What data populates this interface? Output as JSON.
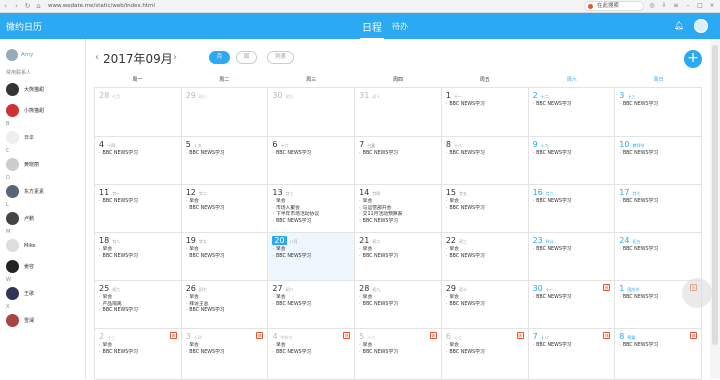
{
  "browser": {
    "url": "www.wedate.me/static/web/index.html",
    "search_text": "在此搜索"
  },
  "header": {
    "app_title": "微约日历",
    "tab_schedule": "日程",
    "tab_todo": "待办",
    "bell_icon": "bell-icon",
    "accent": "#2ba9f3"
  },
  "sidebar": {
    "me": "Amy",
    "frequent_label": "常用联系人",
    "contacts": [
      {
        "name": "大熊猫甜",
        "label": "",
        "top": 0
      },
      {
        "name": "小熊猫甜",
        "label": ""
      },
      {
        "name": "日伞",
        "label": "B"
      },
      {
        "name": "黄晓丽",
        "label": "C"
      },
      {
        "name": "东方素素",
        "label": "D"
      },
      {
        "name": "卢鹏",
        "label": "L"
      },
      {
        "name": "Mike",
        "label": "M"
      },
      {
        "name": "姜容",
        "label": ""
      },
      {
        "name": "王歌",
        "label": "W"
      },
      {
        "name": "雪澜",
        "label": "X"
      }
    ]
  },
  "toolbar": {
    "month": "2017年09月",
    "view_month": "月",
    "view_week": "周",
    "view_list": "列表",
    "add": "+"
  },
  "weekdays": [
    "周一",
    "周二",
    "周三",
    "周四",
    "周五",
    "周六",
    "周日"
  ],
  "weeks": [
    [
      {
        "day": "28",
        "lunar": "七月",
        "other": true,
        "events": []
      },
      {
        "day": "29",
        "lunar": "初八",
        "other": true,
        "events": []
      },
      {
        "day": "30",
        "lunar": "初九",
        "other": true,
        "events": []
      },
      {
        "day": "31",
        "lunar": "初十",
        "other": true,
        "events": []
      },
      {
        "day": "1",
        "lunar": "十一",
        "events": [
          "BBC NEWS学习"
        ]
      },
      {
        "day": "2",
        "lunar": "十二",
        "weekend": true,
        "events": [
          "BBC NEWS学习"
        ]
      },
      {
        "day": "3",
        "lunar": "十三",
        "weekend": true,
        "events": [
          "BBC NEWS学习"
        ]
      }
    ],
    [
      {
        "day": "4",
        "lunar": "十四",
        "events": [
          "BBC NEWS学习"
        ]
      },
      {
        "day": "5",
        "lunar": "十五",
        "events": [
          "BBC NEWS学习"
        ]
      },
      {
        "day": "6",
        "lunar": "十六",
        "events": [
          "BBC NEWS学习"
        ]
      },
      {
        "day": "7",
        "lunar": "白露",
        "events": [
          "BBC NEWS学习"
        ]
      },
      {
        "day": "8",
        "lunar": "十八",
        "events": [
          "BBC NEWS学习"
        ]
      },
      {
        "day": "9",
        "lunar": "十九",
        "weekend": true,
        "events": [
          "BBC NEWS学习"
        ]
      },
      {
        "day": "10",
        "lunar": "教师节",
        "weekend": true,
        "events": [
          "BBC NEWS学习"
        ]
      }
    ],
    [
      {
        "day": "11",
        "lunar": "廿一",
        "events": [
          "BBC NEWS学习"
        ]
      },
      {
        "day": "12",
        "lunar": "廿二",
        "events": [
          "早会",
          "BBC NEWS学习"
        ]
      },
      {
        "day": "13",
        "lunar": "廿三",
        "events": [
          "早会",
          "市场人聚会",
          "下半年市场活动协议",
          "BBC NEWS学习"
        ]
      },
      {
        "day": "14",
        "lunar": "廿四",
        "events": [
          "早会",
          "与运营部开会",
          "交11月活动预算表",
          "BBC NEWS学习"
        ]
      },
      {
        "day": "15",
        "lunar": "廿五",
        "events": [
          "早会",
          "BBC NEWS学习"
        ]
      },
      {
        "day": "16",
        "lunar": "廿六",
        "weekend": true,
        "events": [
          "BBC NEWS学习"
        ]
      },
      {
        "day": "17",
        "lunar": "廿七",
        "weekend": true,
        "events": [
          "BBC NEWS学习"
        ]
      }
    ],
    [
      {
        "day": "18",
        "lunar": "廿八",
        "events": [
          "早会",
          "BBC NEWS学习"
        ]
      },
      {
        "day": "19",
        "lunar": "廿九",
        "events": [
          "早会",
          "BBC NEWS学习"
        ]
      },
      {
        "day": "20",
        "lunar": "八月",
        "today": true,
        "events": [
          "早会",
          "BBC NEWS学习"
        ]
      },
      {
        "day": "21",
        "lunar": "初二",
        "events": [
          "早会",
          "BBC NEWS学习"
        ]
      },
      {
        "day": "22",
        "lunar": "初三",
        "events": [
          "早会",
          "BBC NEWS学习"
        ]
      },
      {
        "day": "23",
        "lunar": "秋分",
        "weekend": true,
        "events": [
          "BBC NEWS学习"
        ]
      },
      {
        "day": "24",
        "lunar": "初五",
        "weekend": true,
        "events": [
          "BBC NEWS学习"
        ]
      }
    ],
    [
      {
        "day": "25",
        "lunar": "初六",
        "events": [
          "早会",
          "产品隔离",
          "BBC NEWS学习"
        ]
      },
      {
        "day": "26",
        "lunar": "初七",
        "events": [
          "早会",
          "拜访王总",
          "BBC NEWS学习"
        ]
      },
      {
        "day": "27",
        "lunar": "初八",
        "events": [
          "早会",
          "BBC NEWS学习"
        ]
      },
      {
        "day": "28",
        "lunar": "初九",
        "events": [
          "早会",
          "BBC NEWS学习"
        ]
      },
      {
        "day": "29",
        "lunar": "初十",
        "events": [
          "早会",
          "BBC NEWS学习"
        ]
      },
      {
        "day": "30",
        "lunar": "十一",
        "weekend": true,
        "holiday": "班",
        "events": [
          "BBC NEWS学习"
        ]
      },
      {
        "day": "1",
        "lunar": "国庆节",
        "weekend": true,
        "other": true,
        "holiday": "休",
        "events": [
          "BBC NEWS学习"
        ]
      }
    ],
    [
      {
        "day": "2",
        "lunar": "十三",
        "other": true,
        "holiday": "休",
        "events": [
          "早会",
          "BBC NEWS学习"
        ]
      },
      {
        "day": "3",
        "lunar": "十四",
        "other": true,
        "holiday": "休",
        "events": [
          "早会",
          "BBC NEWS学习"
        ]
      },
      {
        "day": "4",
        "lunar": "中秋节",
        "other": true,
        "holiday": "休",
        "events": [
          "早会",
          "BBC NEWS学习"
        ]
      },
      {
        "day": "5",
        "lunar": "十六",
        "other": true,
        "holiday": "休",
        "events": [
          "早会",
          "BBC NEWS学习"
        ]
      },
      {
        "day": "6",
        "lunar": "十七",
        "other": true,
        "holiday": "休",
        "events": [
          "早会",
          "BBC NEWS学习"
        ]
      },
      {
        "day": "7",
        "lunar": "十八",
        "weekend": true,
        "other": true,
        "holiday": "休",
        "events": [
          "BBC NEWS学习"
        ]
      },
      {
        "day": "8",
        "lunar": "寒露",
        "weekend": true,
        "other": true,
        "holiday": "休",
        "events": [
          "BBC NEWS学习"
        ]
      }
    ]
  ]
}
